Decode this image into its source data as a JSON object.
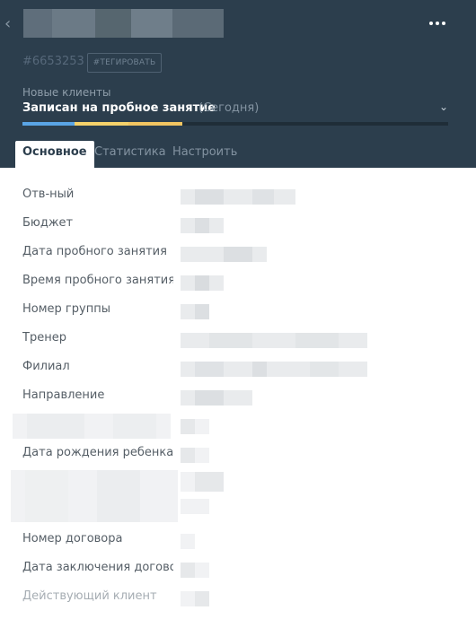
{
  "header": {
    "lead_id": "#6653253",
    "tag_button": "#ТЕГИРОВАТЬ",
    "pipeline": "Новые клиенты",
    "stage": "Записан на пробное занятие",
    "stage_when": "(Сегодня)",
    "progress_colors": [
      "#5aa5e6",
      "#f6d26a",
      "#f3c561"
    ]
  },
  "tabs": [
    {
      "label": "Основное"
    },
    {
      "label": "Статистика"
    },
    {
      "label": "Настроить"
    }
  ],
  "fields": [
    {
      "label": "Отв-ный"
    },
    {
      "label": "Бюджет"
    },
    {
      "label": "Дата пробного занятия"
    },
    {
      "label": "Время пробного занятия"
    },
    {
      "label": "Номер группы"
    },
    {
      "label": "Тренер"
    },
    {
      "label": "Филиал"
    },
    {
      "label": "Направление"
    },
    {
      "label": ""
    },
    {
      "label": "Дата рождения ребенка"
    },
    {
      "label": ""
    },
    {
      "label": "Номер договора"
    },
    {
      "label": "Дата заключения договора"
    },
    {
      "label": "Действующий клиент"
    }
  ],
  "icons": {
    "back": "chevron-left-icon",
    "more": "more-dots-icon",
    "stage_toggle": "chevron-down-icon"
  }
}
